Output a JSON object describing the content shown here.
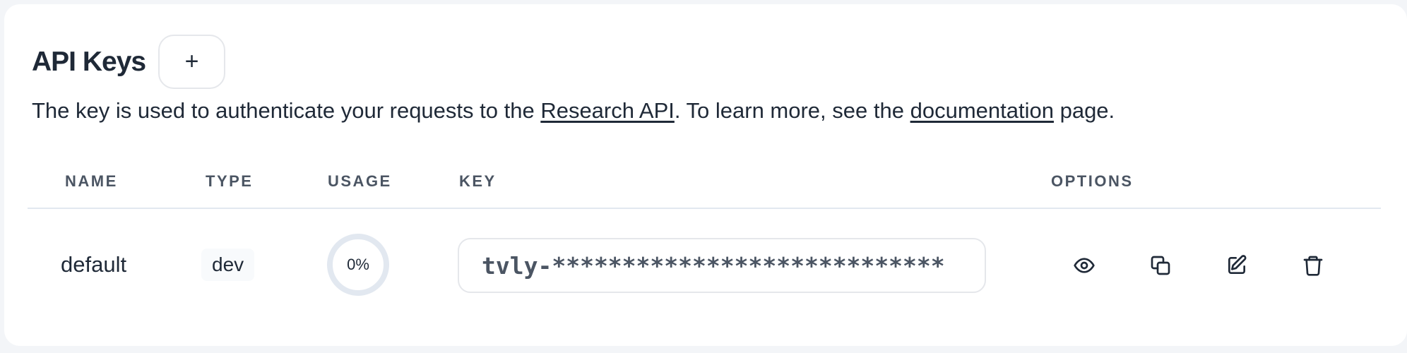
{
  "header": {
    "title": "API Keys",
    "add_label": "+"
  },
  "description": {
    "prefix": "The key is used to authenticate your requests to the ",
    "link1": "Research API",
    "middle": ". To learn more, see the ",
    "link2": "documentation",
    "suffix": " page."
  },
  "table": {
    "columns": [
      "NAME",
      "TYPE",
      "USAGE",
      "KEY",
      "OPTIONS"
    ],
    "rows": [
      {
        "name": "default",
        "type": "dev",
        "usage": "0%",
        "usage_fraction": 0,
        "key": "tvly-****************************"
      }
    ]
  },
  "icons": {
    "view": "eye-icon",
    "copy": "copy-icon",
    "edit": "edit-icon",
    "delete": "trash-icon"
  },
  "colors": {
    "text": "#1f2937",
    "muted": "#4b5563",
    "border": "#e5e7eb",
    "progress_track": "#e2e8f0"
  }
}
